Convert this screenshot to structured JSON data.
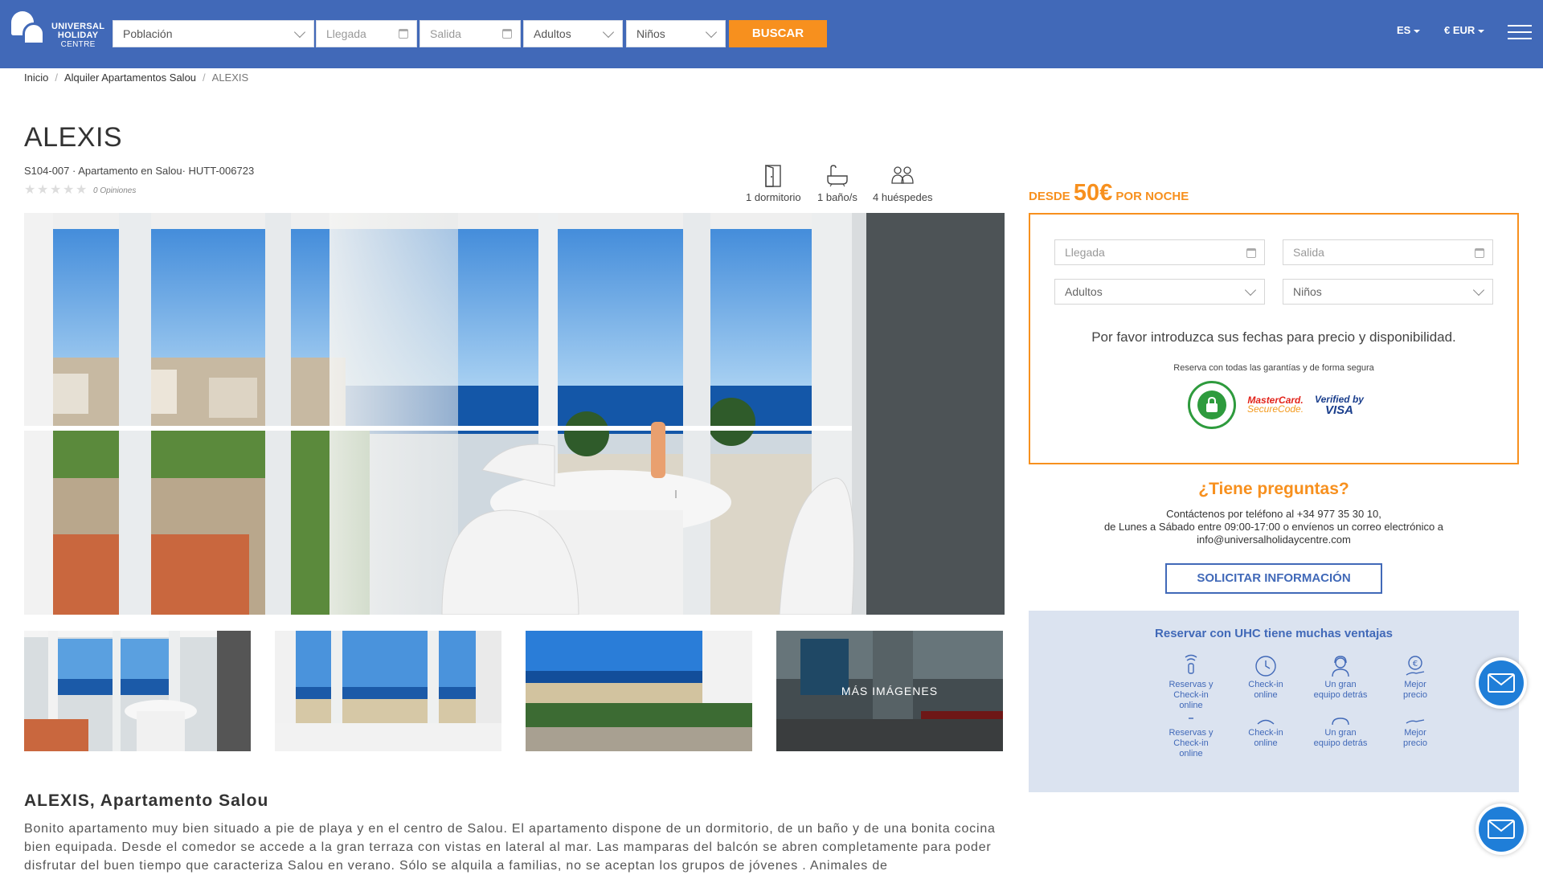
{
  "header": {
    "logo_lines": [
      "UNIVERSAL",
      "HOLIDAY",
      "CENTRE"
    ],
    "search": {
      "poblacion": "Población",
      "llegada": "Llegada",
      "salida": "Salida",
      "adultos": "Adultos",
      "ninos": "Niños",
      "buscar": "BUSCAR"
    },
    "language": "ES",
    "currency": "€ EUR"
  },
  "breadcrumb": [
    "Inicio",
    "Alquiler Apartamentos Salou",
    "ALEXIS"
  ],
  "property": {
    "title": "ALEXIS",
    "subtitle": "S104-007 · Apartamento en Salou· HUTT-006723",
    "rating_stars": 0,
    "opinions": "0 Opiniones",
    "features": {
      "bedrooms": "1 dormitorio",
      "bathrooms": "1 baño/s",
      "guests": "4 huéspedes"
    },
    "more_images": "MÁS IMÁGENES",
    "description_title": "ALEXIS, Apartamento Salou",
    "description": "Bonito apartamento muy bien situado a pie de playa y en el centro de Salou. El apartamento dispone de un dormitorio, de un baño y de una bonita cocina bien equipada. Desde el comedor se accede a la gran terraza con vistas en lateral al mar. Las mamparas del balcón se abren completamente para poder disfrutar del buen tiempo que caracteriza Salou en verano. Sólo se alquila a familias, no se aceptan los grupos de jóvenes . Animales de"
  },
  "booking": {
    "desde": "DESDE",
    "price": "50€",
    "por_noche": "POR NOCHE",
    "llegada": "Llegada",
    "salida": "Salida",
    "adultos": "Adultos",
    "ninos": "Niños",
    "availability_msg": "Por favor introduzca sus fechas para precio y disponibilidad.",
    "secure_msg": "Reserva con todas las garantías y de forma segura",
    "badges": {
      "seal": "RESERVA ONLINE SEGURA",
      "mastercard_1": "MasterCard.",
      "mastercard_2": "SecureCode.",
      "visa_1": "Verified by",
      "visa_2": "VISA"
    }
  },
  "contact": {
    "title": "¿Tiene preguntas?",
    "line1": "Contáctenos por teléfono al +34 977 35 30 10,",
    "line2": "de Lunes a Sábado entre 09:00-17:00 o envíenos un correo electrónico a",
    "line3": "info@universalholidaycentre.com",
    "button": "SOLICITAR INFORMACIÓN"
  },
  "advantages": {
    "title": "Reservar con UHC tiene muchas ventajas",
    "items": [
      {
        "label1": "Reservas y",
        "label2": "Check-in",
        "label3": "online",
        "icon": "wifi-hand-icon"
      },
      {
        "label1": "Check-in",
        "label2": "online",
        "label3": "",
        "icon": "clock-icon"
      },
      {
        "label1": "Un gran",
        "label2": "equipo detrás",
        "label3": "",
        "icon": "support-agent-icon"
      },
      {
        "label1": "Mejor",
        "label2": "precio",
        "label3": "",
        "icon": "euro-hand-icon"
      }
    ]
  },
  "colors": {
    "header_blue": "#4169b8",
    "accent_orange": "#f7901e",
    "panel_light_blue": "#dbe3f0"
  }
}
